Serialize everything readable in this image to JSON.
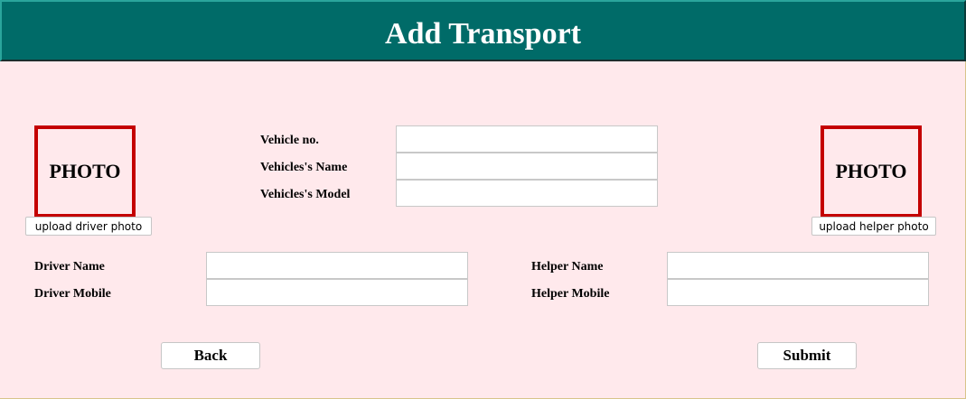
{
  "header": {
    "title": "Add Transport"
  },
  "driver_photo": {
    "placeholder": "PHOTO",
    "upload_label": "upload driver photo"
  },
  "helper_photo": {
    "placeholder": "PHOTO",
    "upload_label": "upload helper photo"
  },
  "vehicle": {
    "number_label": "Vehicle no.",
    "number_value": "",
    "name_label": "Vehicles's Name",
    "name_value": "",
    "model_label": "Vehicles's Model",
    "model_value": ""
  },
  "driver": {
    "name_label": "Driver Name",
    "name_value": "",
    "mobile_label": "Driver Mobile",
    "mobile_value": ""
  },
  "helper": {
    "name_label": "Helper Name",
    "name_value": "",
    "mobile_label": "Helper Mobile",
    "mobile_value": ""
  },
  "actions": {
    "back_label": "Back",
    "submit_label": "Submit"
  },
  "colors": {
    "header_bg": "#006b68",
    "page_bg": "#ffe9ec",
    "photo_border": "#c40000"
  }
}
